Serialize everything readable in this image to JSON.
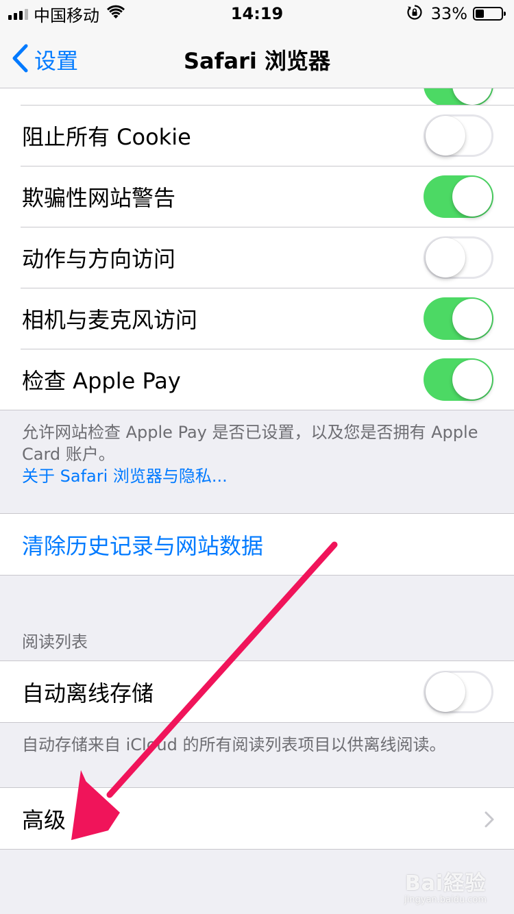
{
  "status_bar": {
    "carrier": "中国移动",
    "time": "14:19",
    "battery_percent": "33%"
  },
  "nav": {
    "back_label": "设置",
    "title": "Safari 浏览器"
  },
  "privacy_section": {
    "rows": [
      {
        "label": "",
        "toggle": "on",
        "partial": true
      },
      {
        "label": "阻止所有 Cookie",
        "toggle": "off"
      },
      {
        "label": "欺骗性网站警告",
        "toggle": "on"
      },
      {
        "label": "动作与方向访问",
        "toggle": "off"
      },
      {
        "label": "相机与麦克风访问",
        "toggle": "on"
      },
      {
        "label": "检查 Apple Pay",
        "toggle": "on"
      }
    ],
    "footer_text": "允许网站检查 Apple Pay 是否已设置，以及您是否拥有 Apple Card 账户。",
    "footer_link": "关于 Safari 浏览器与隐私..."
  },
  "clear_section": {
    "label": "清除历史记录与网站数据"
  },
  "reading_list": {
    "header": "阅读列表",
    "row_label": "自动离线存储",
    "toggle": "off",
    "footer": "自动存储来自 iCloud 的所有阅读列表项目以供离线阅读。"
  },
  "advanced": {
    "label": "高级"
  },
  "watermark": {
    "logo": "Bai経验",
    "sub": "jingyan.baidu.com"
  },
  "colors": {
    "accent": "#007aff",
    "toggle_on": "#4cd964",
    "annotation_arrow": "#f0145a"
  }
}
